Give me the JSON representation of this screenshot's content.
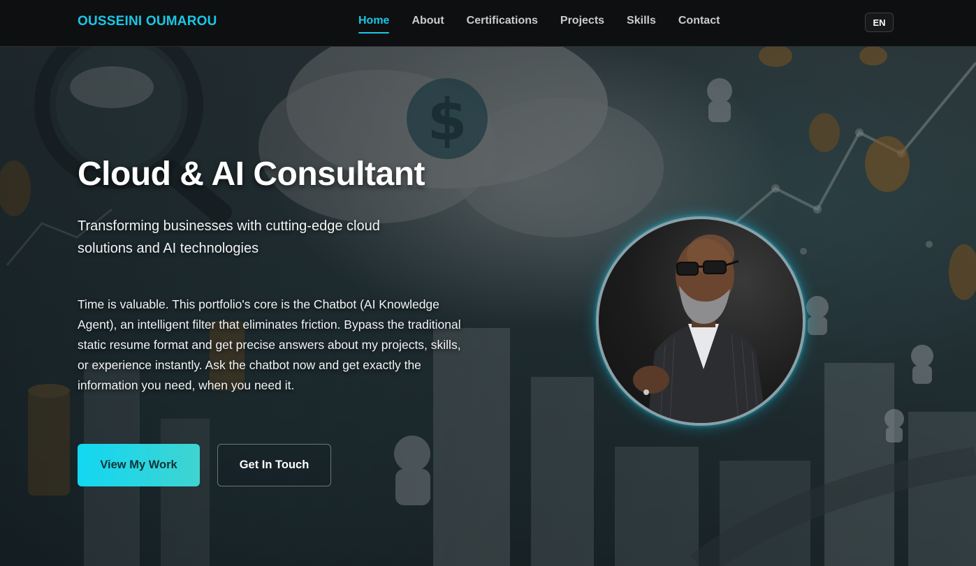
{
  "header": {
    "logo": "OUSSEINI OUMAROU",
    "nav": [
      {
        "label": "Home",
        "active": true
      },
      {
        "label": "About",
        "active": false
      },
      {
        "label": "Certifications",
        "active": false
      },
      {
        "label": "Projects",
        "active": false
      },
      {
        "label": "Skills",
        "active": false
      },
      {
        "label": "Contact",
        "active": false
      }
    ],
    "language": "EN"
  },
  "hero": {
    "title": "Cloud & AI Consultant",
    "subtitle": "Transforming businesses with cutting-edge cloud solutions and AI technologies",
    "description": "Time is valuable. This portfolio's core is the Chatbot (AI Knowledge Agent), an intelligent filter that eliminates friction. Bypass the traditional static resume format and get precise answers about my projects, skills, or experience instantly. Ask the chatbot now and get exactly the information you need, when you need it.",
    "primary_cta": "View My Work",
    "secondary_cta": "Get In Touch"
  },
  "colors": {
    "accent": "#19c7e6",
    "header_bg": "#0e0f10",
    "primary_button": "#12d7f2"
  }
}
